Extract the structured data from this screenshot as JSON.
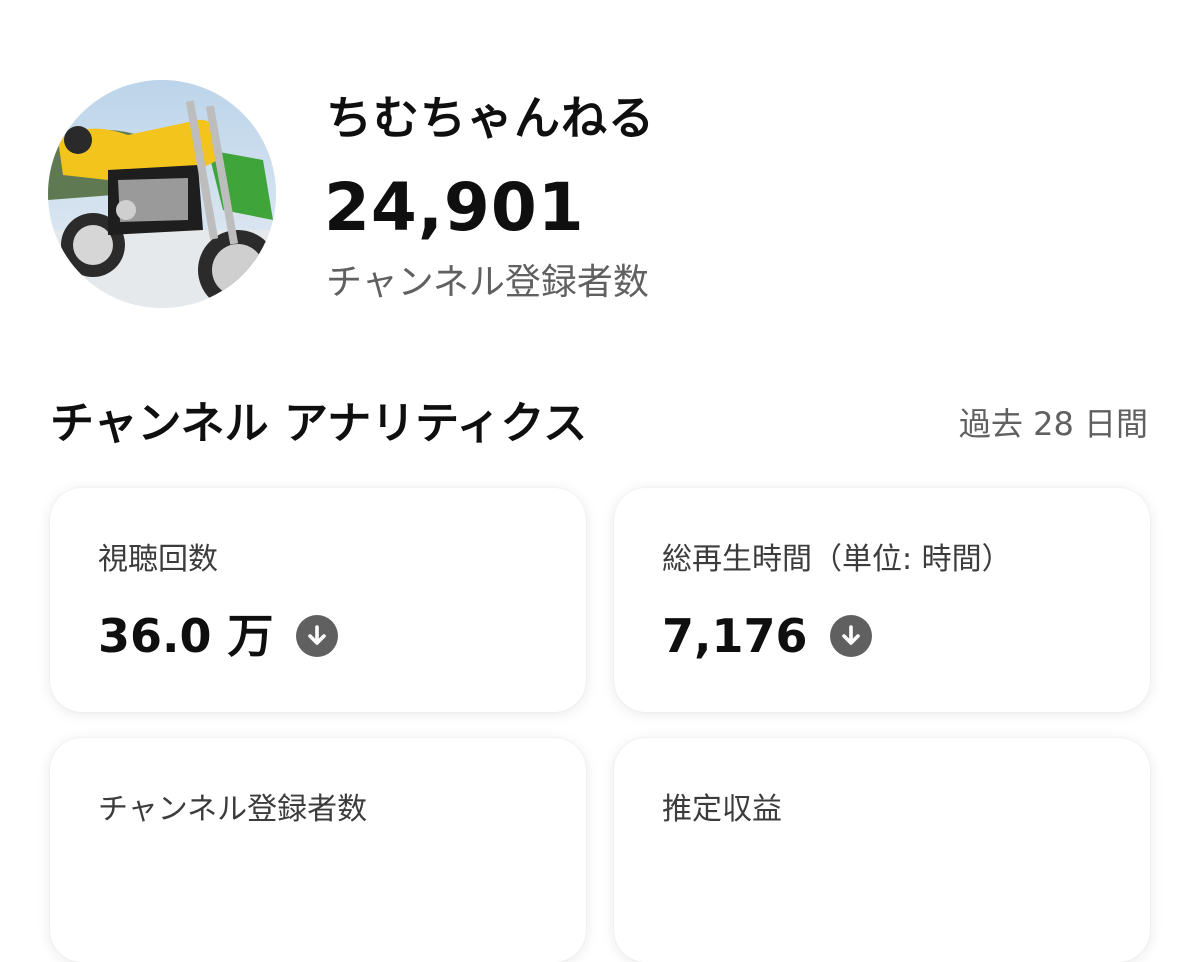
{
  "channel": {
    "name": "ちむちゃんねる",
    "subscriber_count": "24,901",
    "subscriber_label": "チャンネル登録者数",
    "avatar_icon": "motorcycle-avatar"
  },
  "analytics": {
    "title": "チャンネル アナリティクス",
    "period": "過去 28 日間",
    "cards": [
      {
        "label": "視聴回数",
        "value": "36.0 万",
        "trend": "down"
      },
      {
        "label": "総再生時間（単位: 時間）",
        "value": "7,176",
        "trend": "down"
      },
      {
        "label": "チャンネル登録者数"
      },
      {
        "label": "推定収益"
      }
    ]
  },
  "colors": {
    "text_primary": "#0f0f0f",
    "text_secondary": "#606060",
    "trend_icon": "#606060"
  }
}
